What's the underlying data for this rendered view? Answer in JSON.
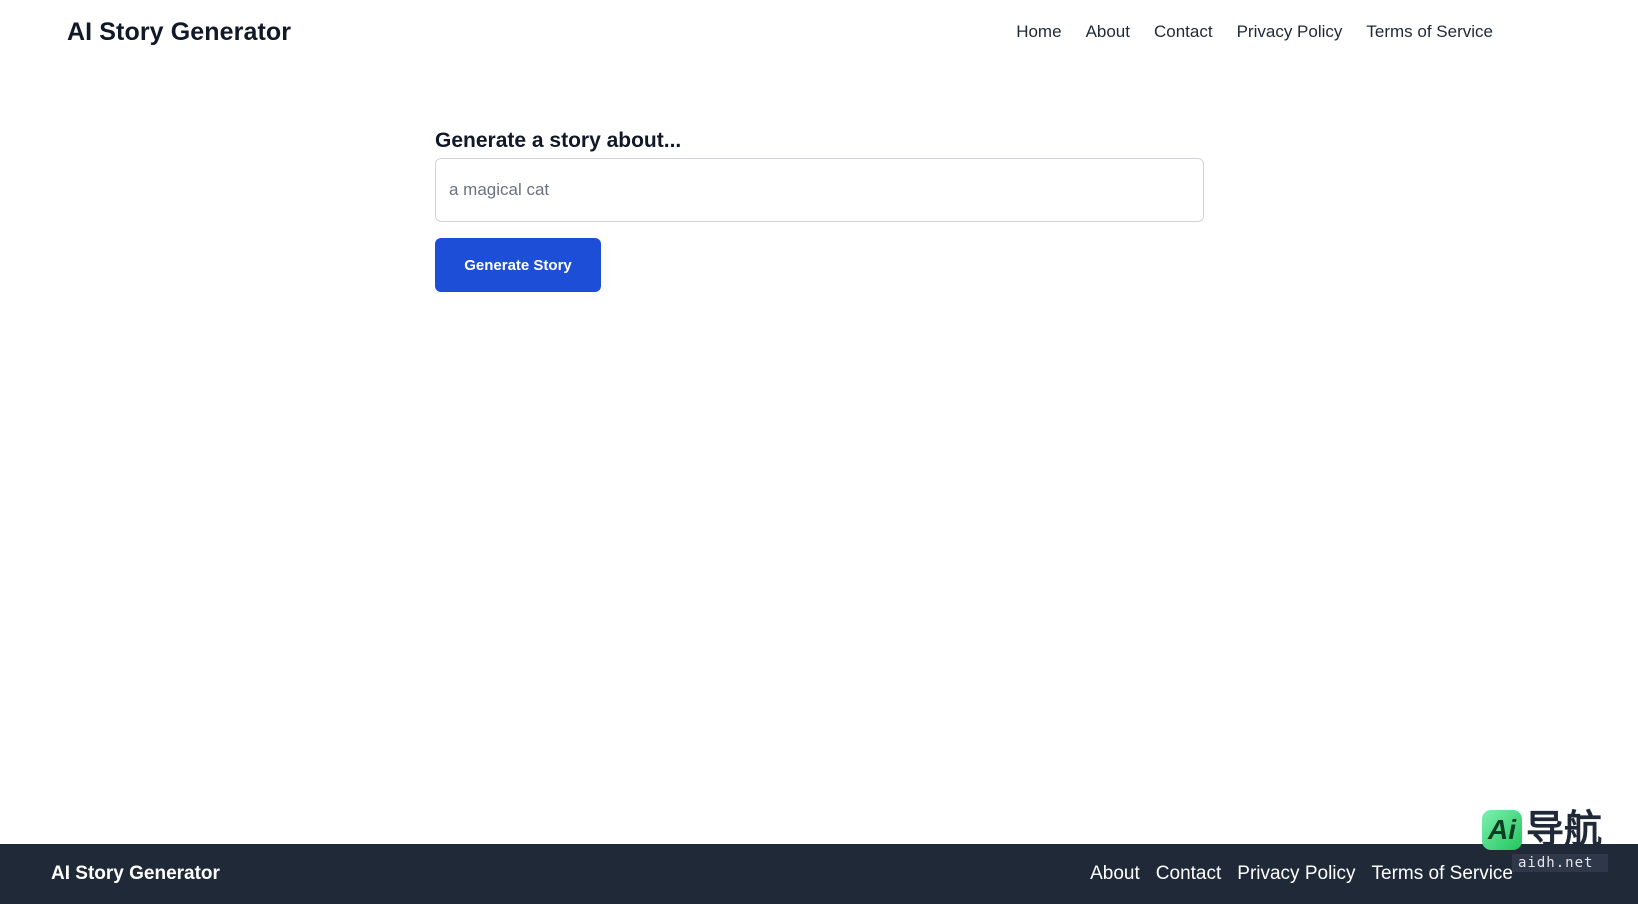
{
  "header": {
    "brand": "AI Story Generator",
    "nav": [
      "Home",
      "About",
      "Contact",
      "Privacy Policy",
      "Terms of Service"
    ]
  },
  "main": {
    "prompt_label": "Generate a story about...",
    "input_placeholder": "a magical cat",
    "input_value": "",
    "button_label": "Generate Story"
  },
  "footer": {
    "brand": "AI Story Generator",
    "nav": [
      "About",
      "Contact",
      "Privacy Policy",
      "Terms of Service"
    ]
  },
  "watermark": {
    "logo_glyph": "Ai",
    "text": "导航",
    "domain": "aidh.net"
  },
  "colors": {
    "primary_button": "#1d4ed8",
    "footer_bg": "#1f2937",
    "text": "#111827"
  }
}
